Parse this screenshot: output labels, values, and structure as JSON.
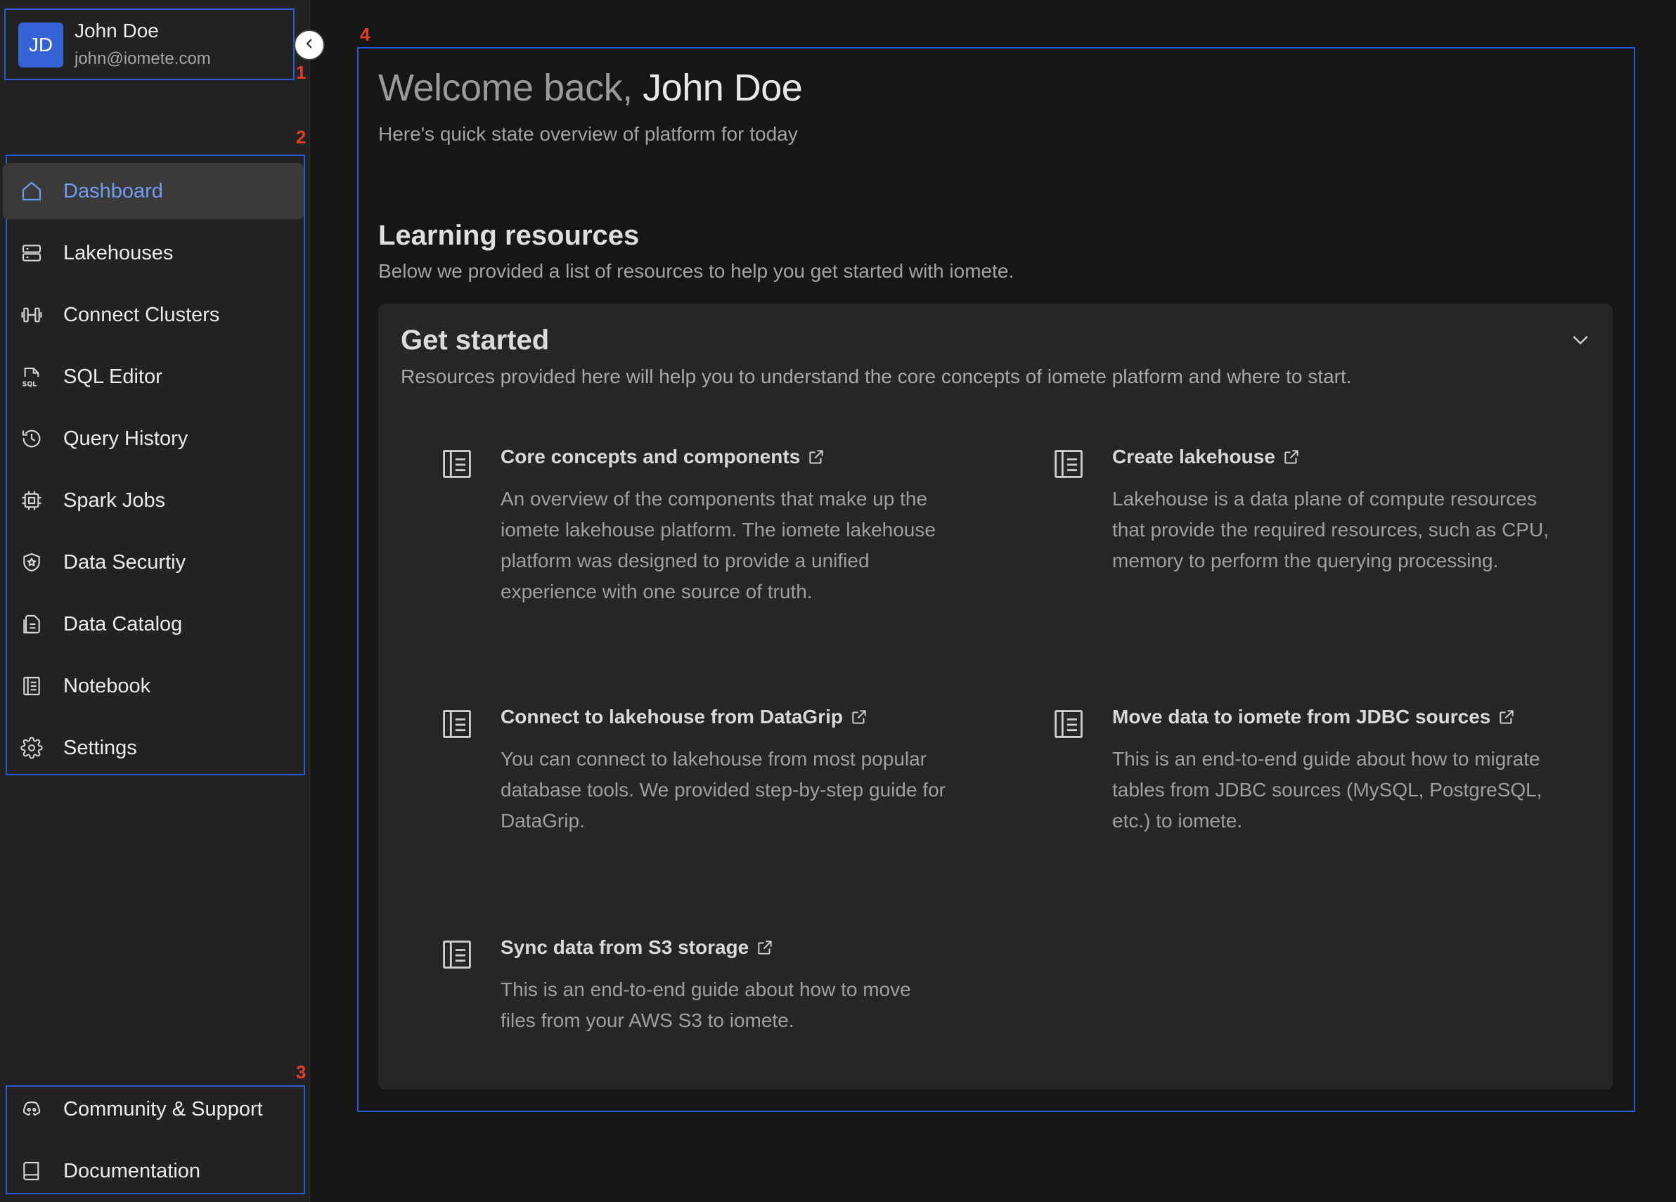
{
  "user": {
    "initials": "JD",
    "name": "John Doe",
    "email": "john@iomete.com"
  },
  "annotations": [
    "1",
    "2",
    "3",
    "4"
  ],
  "nav": {
    "items": [
      {
        "label": "Dashboard",
        "icon": "home-icon",
        "active": true
      },
      {
        "label": "Lakehouses",
        "icon": "server-icon"
      },
      {
        "label": "Connect Clusters",
        "icon": "cluster-icon"
      },
      {
        "label": "SQL Editor",
        "icon": "sql-file-icon"
      },
      {
        "label": "Query History",
        "icon": "history-icon"
      },
      {
        "label": "Spark Jobs",
        "icon": "chip-icon"
      },
      {
        "label": "Data Securtiy",
        "icon": "shield-icon"
      },
      {
        "label": "Data Catalog",
        "icon": "catalog-icon"
      },
      {
        "label": "Notebook",
        "icon": "notebook-icon"
      },
      {
        "label": "Settings",
        "icon": "gear-icon"
      }
    ],
    "bottom": [
      {
        "label": "Community & Support",
        "icon": "discord-icon"
      },
      {
        "label": "Documentation",
        "icon": "book-icon"
      }
    ]
  },
  "main": {
    "welcome_prefix": "Welcome back, ",
    "welcome_name": "John Doe",
    "subtitle": "Here's quick state overview of platform for today",
    "section_title": "Learning resources",
    "section_subtitle": "Below we provided a list of resources to help you get started with iomete.",
    "panel": {
      "title": "Get started",
      "subtitle": "Resources provided here will help you to understand the core concepts of iomete platform and where to start.",
      "resources": [
        {
          "title": "Core concepts and components",
          "description": "An overview of the components that make up the iomete lakehouse platform. The iomete lakehouse platform was designed to provide a unified experience with one source of truth."
        },
        {
          "title": "Create lakehouse",
          "description": "Lakehouse is a data plane of compute resources that provide the required resources, such as CPU, memory to perform the querying processing."
        },
        {
          "title": "Connect to lakehouse from DataGrip",
          "description": "You can connect to lakehouse from most popular database tools. We provided step-by-step guide for DataGrip."
        },
        {
          "title": "Move data to iomete from JDBC sources",
          "description": "This is an end-to-end guide about how to migrate tables from JDBC sources (MySQL, PostgreSQL, etc.) to iomete."
        },
        {
          "title": "Sync data from S3 storage",
          "description": "This is an end-to-end guide about how to move files from your AWS S3 to iomete."
        }
      ]
    }
  },
  "colors": {
    "accent": "#3563d6",
    "active_text": "#6f9df0",
    "annotation_box": "#2a5bd7",
    "annotation_num": "#e53b2c"
  }
}
